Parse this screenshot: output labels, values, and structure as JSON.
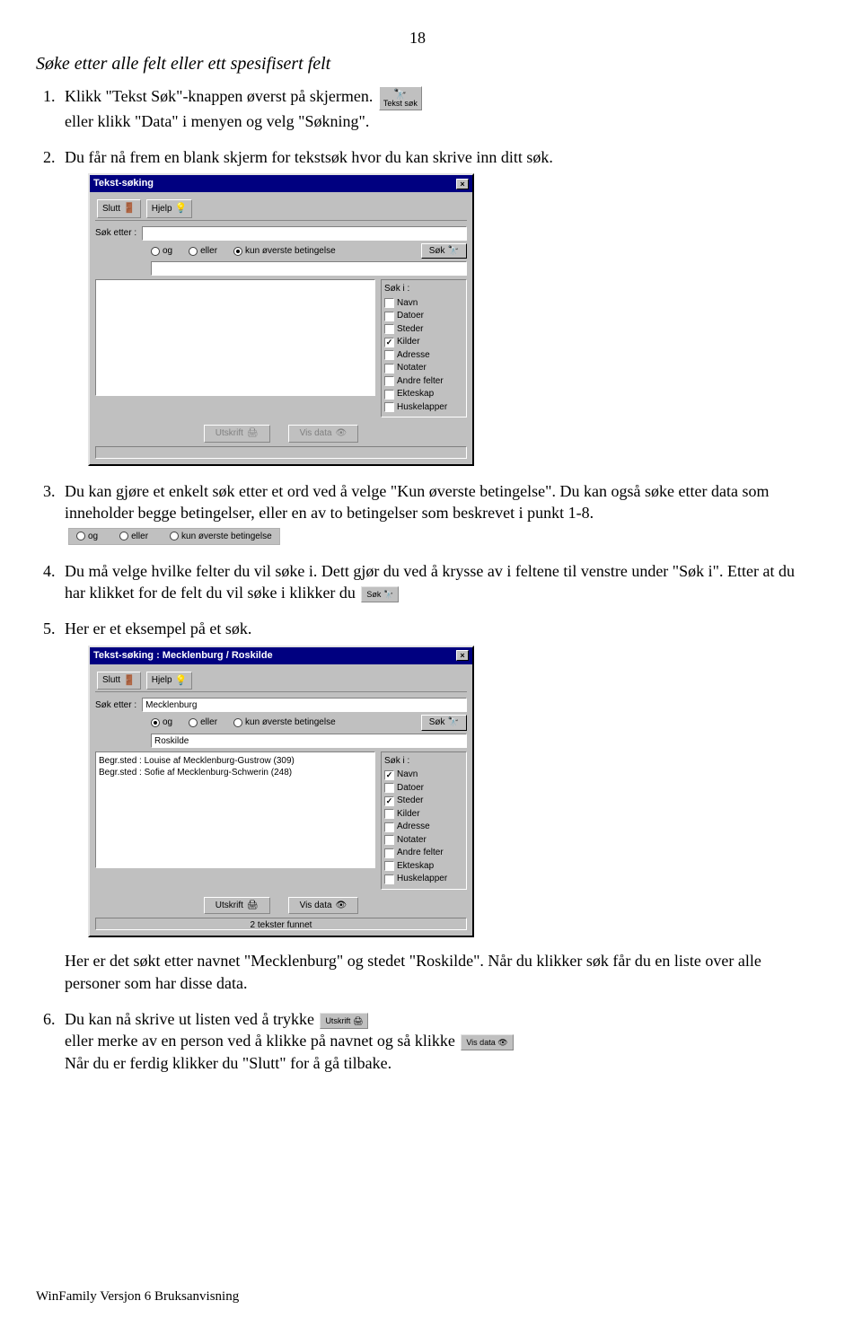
{
  "page_number": "18",
  "section_heading": "Søke etter alle felt eller ett spesifisert felt",
  "inline_buttons": {
    "tekst_sok": "Tekst søk",
    "sok": "Søk",
    "utskrift": "Utskrift",
    "vis_data": "Vis data"
  },
  "steps": {
    "s1a": "Klikk \"Tekst Søk\"-knappen øverst på skjermen.",
    "s1b": "eller klikk \"Data\" i menyen og velg \"Søkning\".",
    "s2": "Du får nå frem en blank skjerm for tekstsøk hvor du kan skrive inn ditt søk.",
    "s3a": "Du kan gjøre et enkelt søk etter et ord ved å velge \"Kun øverste betingelse\". Du kan også søke etter data som inneholder begge betingelser, eller en av to betingelser som beskrevet i punkt 1-8.",
    "s4": "Du må velge hvilke felter du vil søke i. Dett gjør du ved å krysse av i feltene til venstre under \"Søk i\". Etter at du har klikket for de felt du vil søke i klikker du",
    "s5": "Her er et eksempel på et søk.",
    "s5b": "Her er det søkt etter navnet \"Mecklenburg\" og stedet \"Roskilde\". Når du klikker søk får du en liste over alle personer som har disse data.",
    "s6a": "Du kan nå skrive ut listen ved å trykke",
    "s6b": "eller merke av en person ved å klikke på navnet og så klikke",
    "s6c": "Når du er ferdig klikker du \"Slutt\" for å gå tilbake."
  },
  "radio_strip": {
    "og": "og",
    "eller": "eller",
    "kun": "kun øverste betingelse"
  },
  "dialog1": {
    "title": "Tekst-søking",
    "toolbar": {
      "slutt": "Slutt",
      "hjelp": "Hjelp"
    },
    "sok_etter": "Søk etter :",
    "radios": {
      "og": "og",
      "eller": "eller",
      "kun": "kun øverste betingelse"
    },
    "sok_btn": "Søk",
    "input1": "",
    "input2": "",
    "sok_i_label": "Søk i :",
    "checks": [
      {
        "label": "Navn",
        "on": false
      },
      {
        "label": "Datoer",
        "on": false
      },
      {
        "label": "Steder",
        "on": false
      },
      {
        "label": "Kilder",
        "on": true
      },
      {
        "label": "Adresse",
        "on": false
      },
      {
        "label": "Notater",
        "on": false
      },
      {
        "label": "Andre felter",
        "on": false
      },
      {
        "label": "Ekteskap",
        "on": false
      },
      {
        "label": "Huskelapper",
        "on": false
      }
    ],
    "utskrift": "Utskrift",
    "vis_data": "Vis data",
    "status": ""
  },
  "dialog2": {
    "title": "Tekst-søking : Mecklenburg / Roskilde",
    "toolbar": {
      "slutt": "Slutt",
      "hjelp": "Hjelp"
    },
    "sok_etter": "Søk etter :",
    "radios": {
      "og": "og",
      "eller": "eller",
      "kun": "kun øverste betingelse"
    },
    "sok_btn": "Søk",
    "input1": "Mecklenburg",
    "input2": "Roskilde",
    "results": [
      "Begr.sted : Louise af Mecklenburg-Gustrow (309)",
      "Begr.sted : Sofie af Mecklenburg-Schwerin (248)"
    ],
    "sok_i_label": "Søk i :",
    "checks": [
      {
        "label": "Navn",
        "on": true
      },
      {
        "label": "Datoer",
        "on": false
      },
      {
        "label": "Steder",
        "on": true
      },
      {
        "label": "Kilder",
        "on": false
      },
      {
        "label": "Adresse",
        "on": false
      },
      {
        "label": "Notater",
        "on": false
      },
      {
        "label": "Andre felter",
        "on": false
      },
      {
        "label": "Ekteskap",
        "on": false
      },
      {
        "label": "Huskelapper",
        "on": false
      }
    ],
    "utskrift": "Utskrift",
    "vis_data": "Vis data",
    "status": "2 tekster funnet"
  },
  "footer": "WinFamily Versjon 6 Bruksanvisning"
}
